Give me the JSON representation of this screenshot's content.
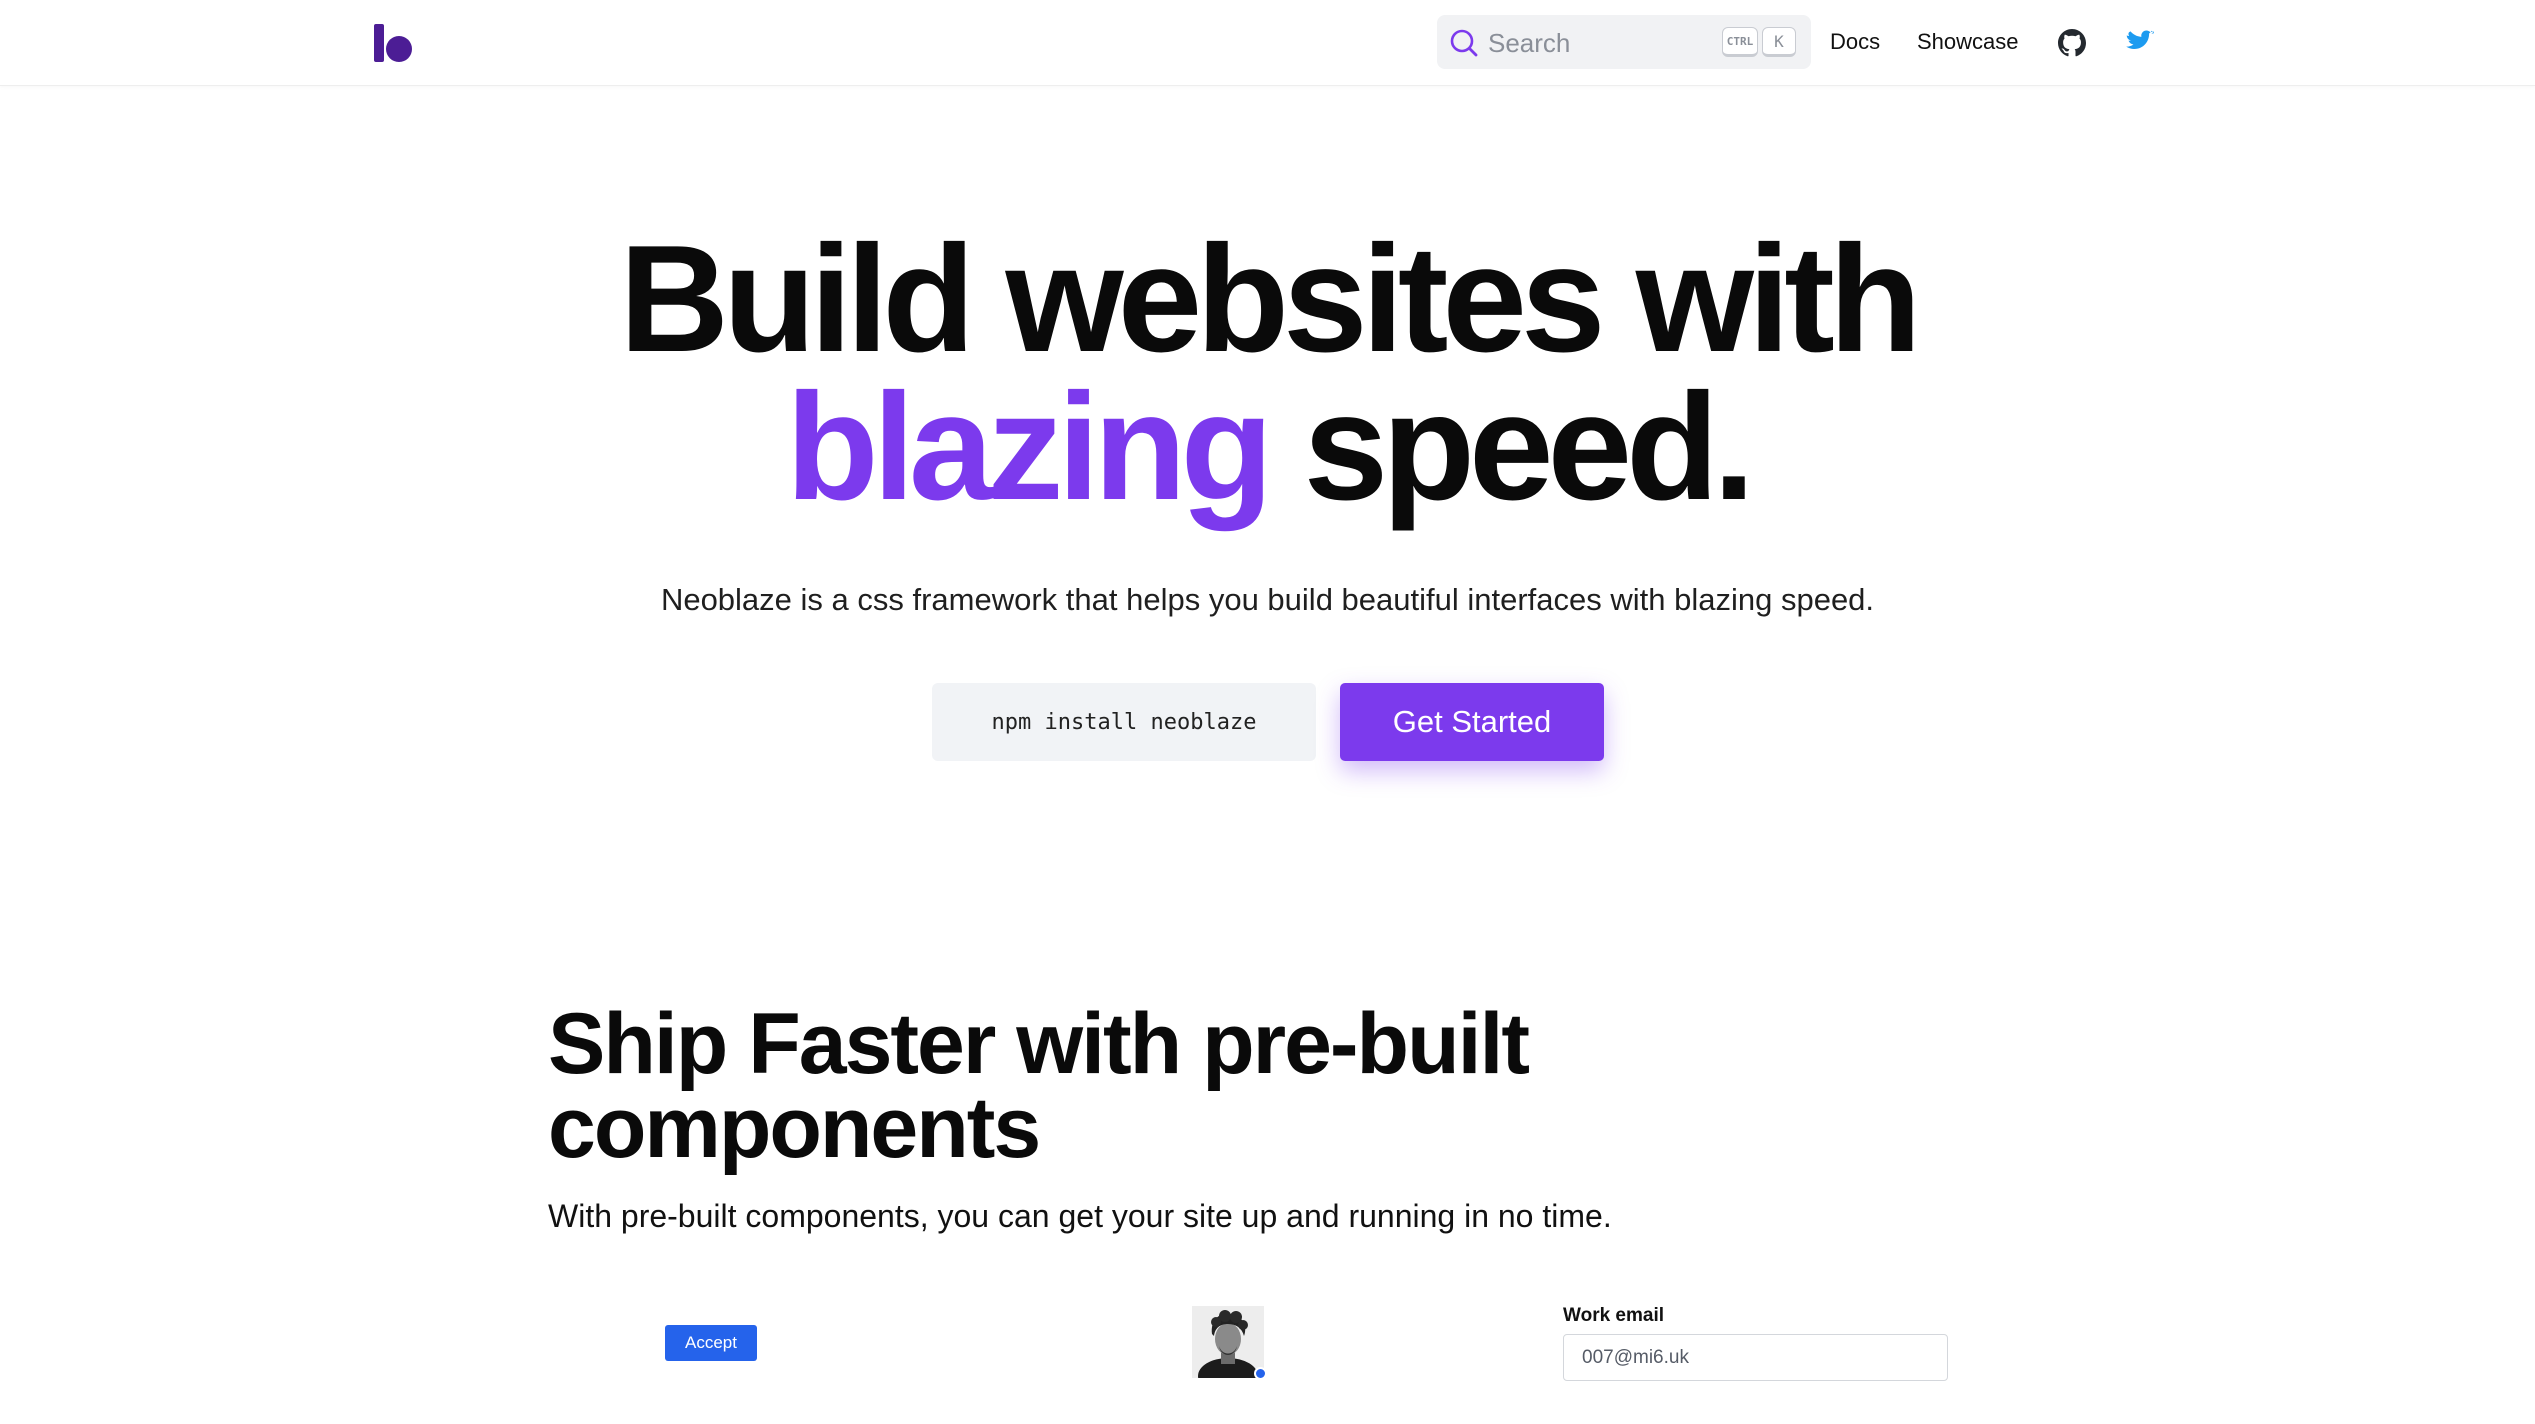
{
  "header": {
    "logo_icon": "neoblaze-logo",
    "search": {
      "placeholder": "Search",
      "icon": "search-icon",
      "shortcut_ctrl": "CTRL",
      "shortcut_key": "K"
    },
    "nav": {
      "docs": "Docs",
      "showcase": "Showcase",
      "github_icon": "github-icon",
      "twitter_icon": "twitter-icon"
    }
  },
  "hero": {
    "title_line1": "Build websites with",
    "title_accent": "blazing",
    "title_line2_rest": " speed.",
    "subtitle": "Neoblaze is a css framework that helps you build beautiful interfaces with blazing speed.",
    "install_command": "npm install neoblaze",
    "cta_label": "Get Started"
  },
  "components": {
    "title": "Ship Faster with pre-built components",
    "subtitle": "With pre-built components, you can get your site up and running in no time.",
    "demo_button_label": "Accept",
    "email_label": "Work email",
    "email_value": "007@mi6.uk"
  },
  "colors": {
    "accent": "#7c3aed",
    "logo": "#4c1d95",
    "blue": "#2563eb",
    "twitter": "#1d9bf0"
  }
}
